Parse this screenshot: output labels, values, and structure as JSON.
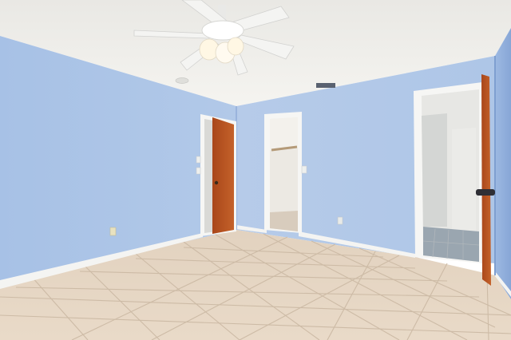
{
  "scene": {
    "kind": "empty bedroom interior",
    "colors": {
      "wall": "#a9c3e6",
      "wall_shadow": "#8fadd8",
      "ceiling": "#f1f0ec",
      "floor_tile": "#e6d6c3",
      "grout": "#cdbba6",
      "baseboard": "#f4f4f2",
      "door_wood": "#b8541c",
      "door_trim": "#f6f6f4",
      "closet_interior": "#ece9e3"
    },
    "icons": [
      "ceiling-fan-icon",
      "door-icon",
      "light-switch-icon",
      "outlet-icon",
      "air-vent-icon",
      "smoke-detector-icon"
    ]
  }
}
